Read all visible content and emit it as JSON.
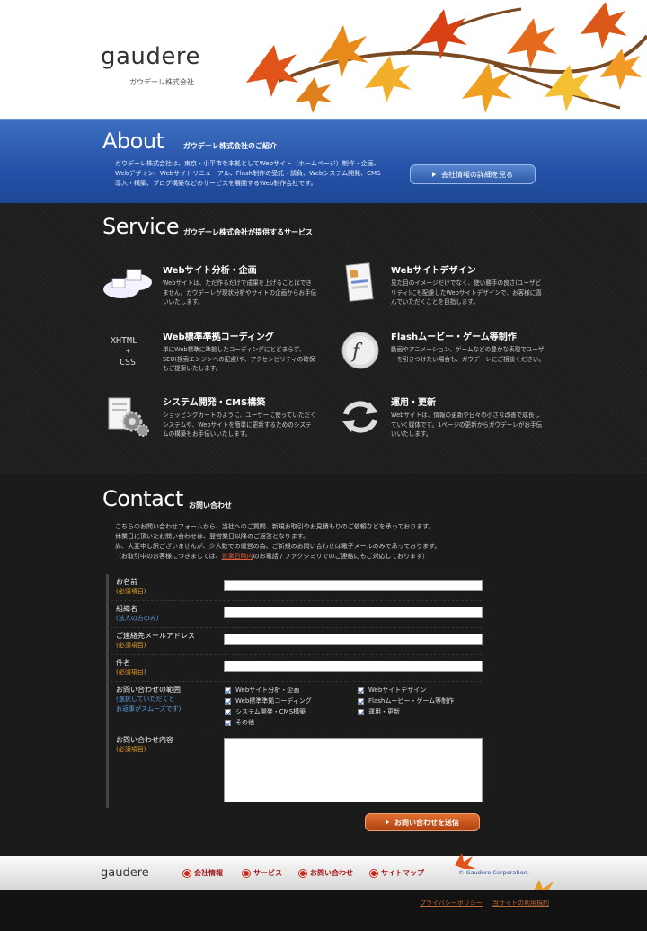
{
  "header": {
    "logo": "gaudere",
    "company": "ガウデーレ株式会社"
  },
  "about": {
    "title": "About",
    "subtitle": "ガウデーレ株式会社のご紹介",
    "text": "ガウデーレ株式会社は、東京・小平市を本拠としてWebサイト（ホームページ）制作・企画、Webデザイン、Webサイトリニューアル、Flash制作の受託・請負、Webシステム開発、CMS導入・構築、ブログ構築などのサービスを展開するWeb制作会社です。",
    "button": "会社情報の詳細を見る"
  },
  "service": {
    "title": "Service",
    "subtitle": "ガウデーレ株式会社が提供するサービス",
    "items": [
      {
        "title": "Webサイト分析・企画",
        "desc": "Webサイトは、ただ作るだけで成果を上げることはできません。ガウデーレが現状分析やサイトの企画からお手伝いいたします。",
        "icon_text": ""
      },
      {
        "title": "Webサイトデザイン",
        "desc": "見た目のイメージだけでなく、使い勝手の良さ(ユーザビリティ)にも配慮したWebサイトデザインで、お客様に喜んでいただくことを目指します。",
        "icon_text": ""
      },
      {
        "title": "Web標準準拠コーディング",
        "desc": "単にWeb標準に準拠したコーディングにとどまらず、SEO(検索エンジンへの配慮)や、アクセシビリティの確保もご提案いたします。",
        "icon_text": "XHTML + CSS"
      },
      {
        "title": "Flashムービー・ゲーム等制作",
        "desc": "動画やアニメーション、ゲームなどの豊かな表現でユーザーを引きつけたい場合も、ガウデーレにご相談ください。",
        "icon_text": ""
      },
      {
        "title": "システム開発・CMS構築",
        "desc": "ショッピングカートのように、ユーザーに使っていただくシステムや、Webサイトを簡単に更新するためのシステムの構築もお手伝いいたします。",
        "icon_text": ""
      },
      {
        "title": "運用・更新",
        "desc": "Webサイトは、情報の更新や日々の小さな改善で成長していく媒体です。1ページの更新からガウデーレがお手伝いいたします。",
        "icon_text": ""
      }
    ]
  },
  "contact": {
    "title": "Contact",
    "subtitle": "お問い合わせ",
    "text1": "こちらのお問い合わせフォームから、当社へのご質問、新規お取引やお見積もりのご依頼などを承っております。",
    "text2": "休業日に頂いたお問い合わせは、翌営業日以降のご返答となります。",
    "text3": "尚、大変申し訳ございませんが、少人数での運営の為、ご新規のお問い合わせは電子メールのみで承っております。",
    "text4a": "（お取引中のお客様につきましては、",
    "text4link": "営業日時内",
    "text4b": "のお電話 / ファクシミリでのご連絡にもご対応しております）",
    "fields": [
      {
        "label": "お名前",
        "note": "(必須項目)"
      },
      {
        "label": "組織名",
        "note": "(法人の方のみ)"
      },
      {
        "label": "ご連絡先メールアドレス",
        "note": "(必須項目)"
      },
      {
        "label": "件名",
        "note": "(必須項目)"
      }
    ],
    "range": {
      "label": "お問い合わせの範囲",
      "note1": "(選択していただくと",
      "note2": "お返事がスムーズです)",
      "options": [
        "Webサイト分析・企画",
        "Webサイトデザイン",
        "Web標準準拠コーディング",
        "Flashムービー・ゲーム等制作",
        "システム開発・CMS構築",
        "運用・更新",
        "その他"
      ]
    },
    "message": {
      "label": "お問い合わせ内容",
      "note": "(必須項目)"
    },
    "submit": "お問い合わせを送信"
  },
  "footer": {
    "logo": "gaudere",
    "nav": [
      "会社情報",
      "サービス",
      "お問い合わせ",
      "サイトマップ"
    ],
    "copyright": "© Gaudere Corporation.",
    "links": [
      "プライバシーポリシー",
      "当サイトの利用規約"
    ]
  },
  "colors": {
    "about_blue": "#2552a8",
    "accent_orange": "#c8521f",
    "nav_red": "#c8281a"
  }
}
